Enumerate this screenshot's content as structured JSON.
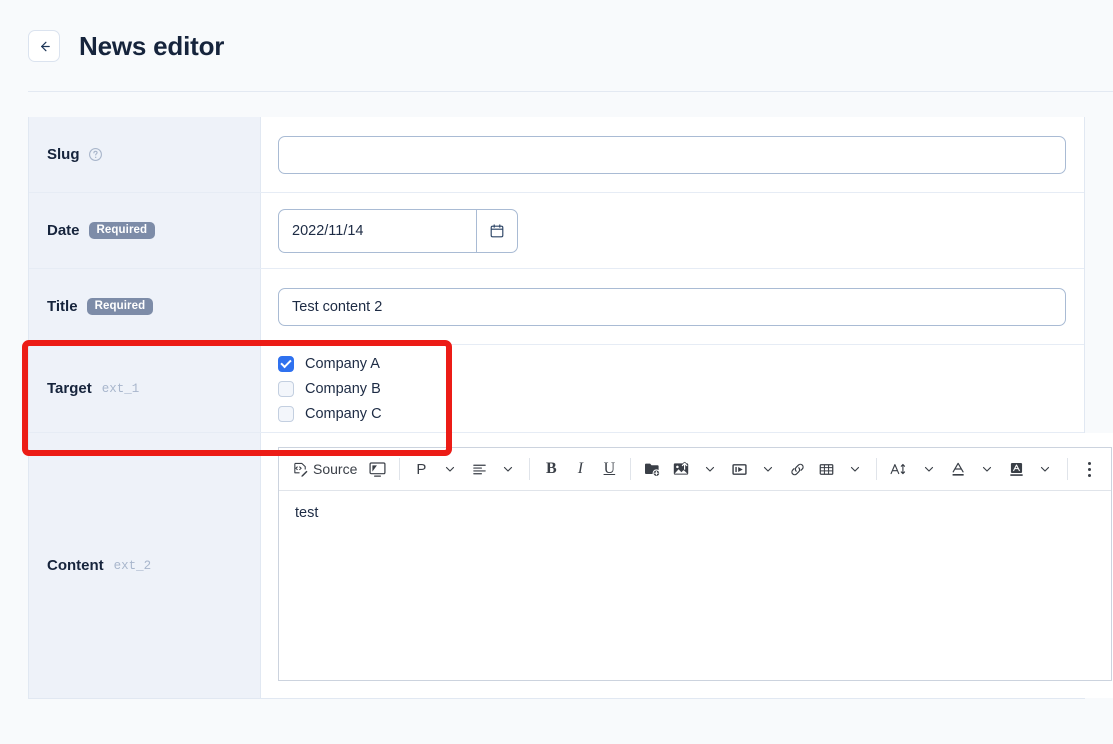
{
  "header": {
    "back_icon": "arrow-left-icon",
    "title": "News editor"
  },
  "form": {
    "rows": [
      {
        "label": "Slug",
        "help_icon": "question-circle-icon",
        "value": "",
        "placeholder": ""
      },
      {
        "label": "Date",
        "badge": "Required",
        "value": "2022/11/14",
        "calendar_icon": "calendar-icon"
      },
      {
        "label": "Title",
        "badge": "Required",
        "value": "Test content 2",
        "placeholder": ""
      },
      {
        "label": "Target",
        "note": "ext_1",
        "options": [
          {
            "label": "Company A",
            "checked": true
          },
          {
            "label": "Company B",
            "checked": false
          },
          {
            "label": "Company C",
            "checked": false
          }
        ]
      },
      {
        "label": "Content",
        "note": "ext_2",
        "body_text": "test"
      }
    ]
  },
  "toolbar": {
    "source_label": "Source",
    "source_icon": "source-code-icon",
    "fullscreen_icon": "maximize-screen-icon",
    "paragraph_label": "P",
    "paragraph_icon": "paragraph-format-icon",
    "align_icon": "align-left-icon",
    "bold_label": "B",
    "italic_label": "I",
    "underline_label": "U",
    "file_icon": "folder-add-icon",
    "image_icon": "image-upload-icon",
    "video_icon": "video-icon",
    "link_icon": "link-icon",
    "table_icon": "table-icon",
    "font_size_icon": "font-size-icon",
    "font_color_icon": "font-color-icon",
    "bg_color_icon": "background-color-icon",
    "more_icon": "more-vertical-icon"
  },
  "colors": {
    "accent_blue": "#2f71ef",
    "highlight_red": "#ec1c16",
    "badge_slate": "#7d8ca8",
    "label_bg": "#eef2f9"
  }
}
